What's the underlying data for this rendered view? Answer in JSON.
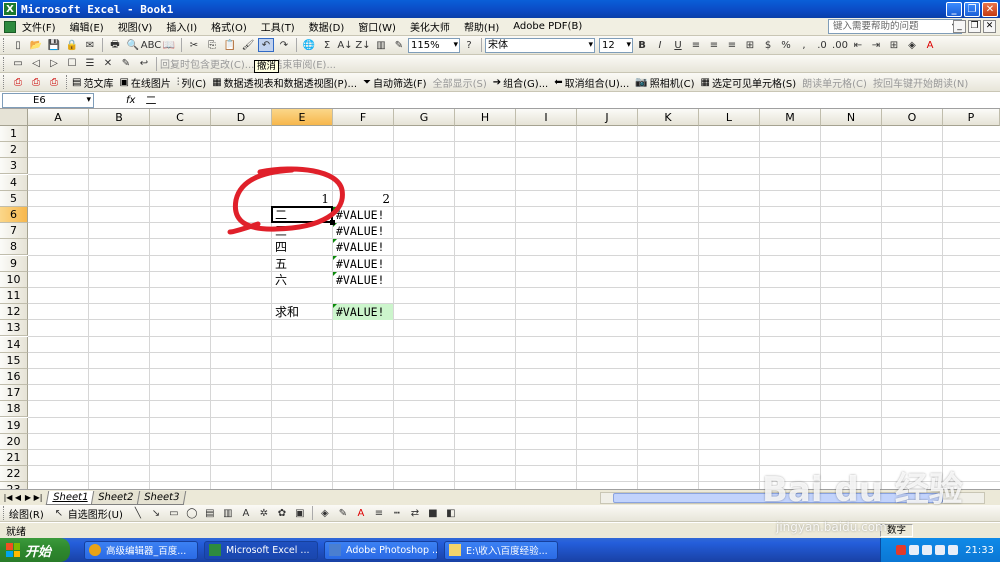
{
  "window": {
    "title": "Microsoft Excel - Book1",
    "app_icon_glyph": "X"
  },
  "menu": {
    "items": [
      "文件(F)",
      "编辑(E)",
      "视图(V)",
      "插入(I)",
      "格式(O)",
      "工具(T)",
      "数据(D)",
      "窗口(W)",
      "美化大师",
      "帮助(H)",
      "Adobe PDF(B)"
    ],
    "help_placeholder": "键入需要帮助的问题"
  },
  "toolbar": {
    "zoom": "115%",
    "font_name": "宋体",
    "font_size": "12",
    "undo_tooltip": "撤消"
  },
  "toolbar2": {
    "items": [
      "回复时包含更改(C)...",
      "结束审阅(E)..."
    ]
  },
  "toolbar3": {
    "items": [
      "范文库",
      "在线图片",
      "列(C)",
      "数据透视表和数据透视图(P)...",
      "自动筛选(F)",
      "全部显示(S)",
      "组合(G)...",
      "取消组合(U)...",
      "照相机(C)",
      "选定可见单元格(S)",
      "朗读单元格(C)",
      "按回车键开始朗读(N)"
    ]
  },
  "formula_bar": {
    "name_box": "E6",
    "fx_label": "fx",
    "formula": "二"
  },
  "grid": {
    "columns": [
      "A",
      "B",
      "C",
      "D",
      "E",
      "F",
      "G",
      "H",
      "I",
      "J",
      "K",
      "L",
      "M",
      "N",
      "O",
      "P"
    ],
    "rows": [
      "1",
      "2",
      "3",
      "4",
      "5",
      "6",
      "7",
      "8",
      "9",
      "10",
      "11",
      "12",
      "13",
      "14",
      "15",
      "16",
      "17",
      "18",
      "19",
      "20",
      "21",
      "22",
      "23"
    ],
    "cells": {
      "E5": "1",
      "F5": "2",
      "E6": "二",
      "E7": "三",
      "E8": "四",
      "E9": "五",
      "E10": "六",
      "E12": "求和",
      "F6": "#VALUE!",
      "F7": "#VALUE!",
      "F8": "#VALUE!",
      "F9": "#VALUE!",
      "F10": "#VALUE!",
      "F12": "#VALUE!"
    },
    "active_cell": "E6",
    "annotation_color": "#E0202A"
  },
  "sheets": {
    "tabs": [
      "Sheet1",
      "Sheet2",
      "Sheet3"
    ],
    "active": "Sheet1"
  },
  "drawing_toolbar": {
    "draw_label": "绘图(R)",
    "autoshape_label": "自选图形(U)"
  },
  "status": {
    "ready": "就绪",
    "numlock": "数字"
  },
  "taskbar": {
    "start_label": "开始",
    "tasks": [
      "高级编辑器_百度...",
      "Microsoft Excel ...",
      "Adobe Photoshop ...",
      "E:\\收入\\百度经验..."
    ],
    "clock": "21:33"
  },
  "watermark": {
    "logo_text": "Bai du 经验",
    "url": "jingyan.baidu.com"
  }
}
